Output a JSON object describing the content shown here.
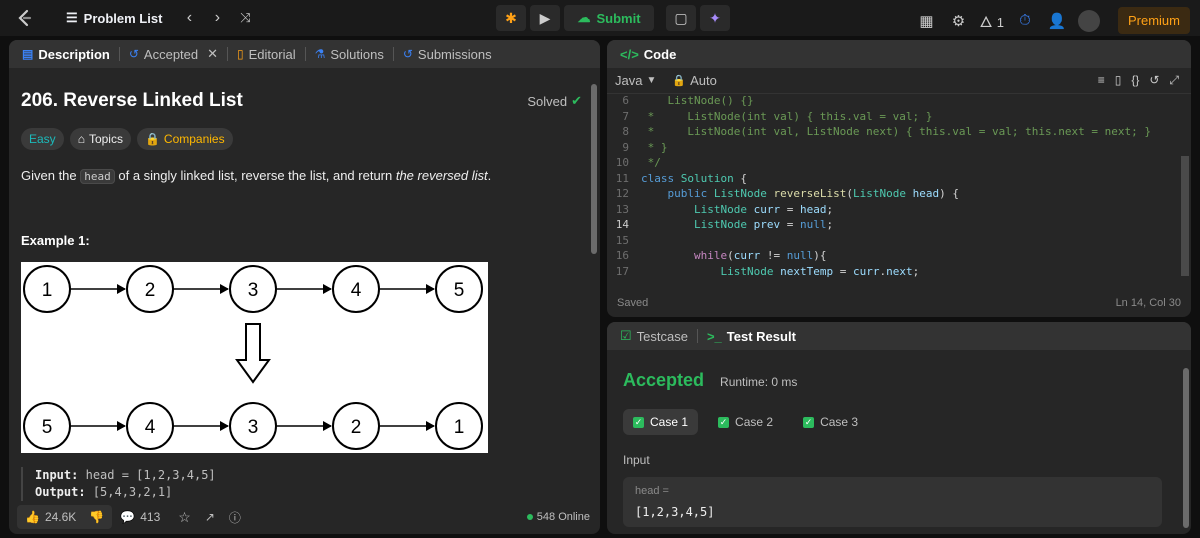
{
  "topbar": {
    "title": "Problem List",
    "submit": "Submit",
    "streak": "1",
    "premium": "Premium"
  },
  "left_tabs": [
    "Description",
    "Accepted",
    "Editorial",
    "Solutions",
    "Submissions"
  ],
  "problem": {
    "title": "206. Reverse Linked List",
    "status": "Solved",
    "tags": [
      "Easy",
      "Topics",
      "Companies"
    ],
    "text_before": "Given the ",
    "text_code": "head",
    "text_mid": " of a singly linked list, reverse the list, and return ",
    "text_em": "the reversed list",
    "text_end": ".",
    "example_title": "Example 1:",
    "input_label": "Input:",
    "input_value": "head = [1,2,3,4,5]",
    "output_label": "Output:",
    "output_value": "[5,4,3,2,1]",
    "top_list": [
      "1",
      "2",
      "3",
      "4",
      "5"
    ],
    "bottom_list": [
      "5",
      "4",
      "3",
      "2",
      "1"
    ]
  },
  "bottombar": {
    "likes": "24.6K",
    "comments": "413",
    "online": "548 Online"
  },
  "code": {
    "tab": "Code",
    "language": "Java",
    "mode": "Auto",
    "status_left": "Saved",
    "status_right": "Ln 14, Col 30",
    "line_numbers": [
      "6",
      "7",
      "8",
      "9",
      "10",
      "11",
      "12",
      "13",
      "14",
      "15",
      "16",
      "17"
    ]
  },
  "result": {
    "tab_testcase": "Testcase",
    "tab_result": "Test Result",
    "verdict": "Accepted",
    "runtime": "Runtime: 0 ms",
    "cases": [
      "Case 1",
      "Case 2",
      "Case 3"
    ],
    "input_label": "Input",
    "var_label": "head =",
    "var_value": "[1,2,3,4,5]"
  }
}
